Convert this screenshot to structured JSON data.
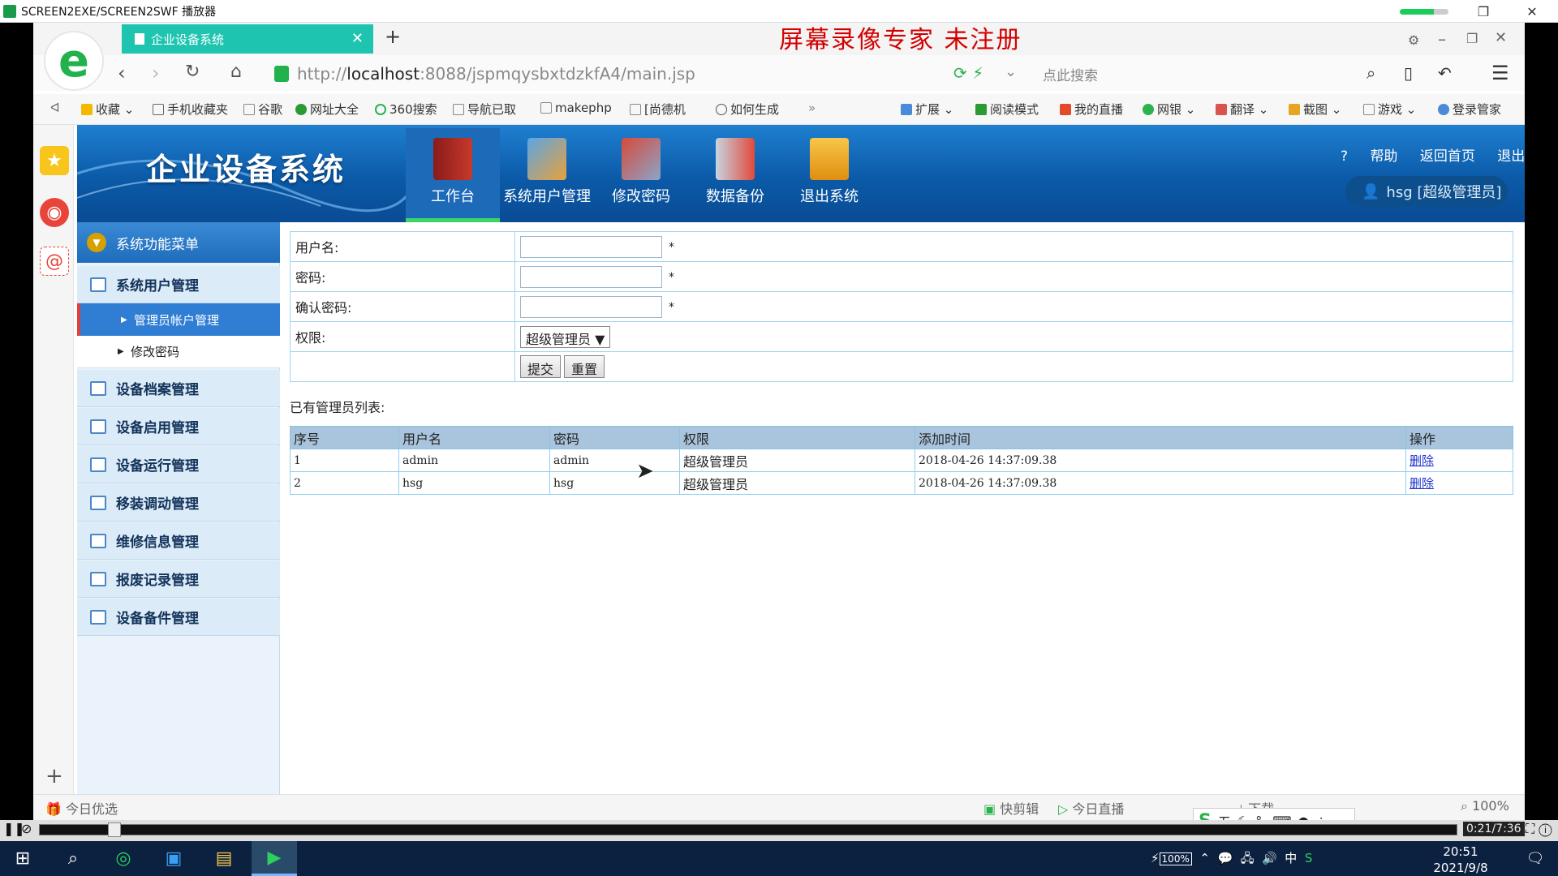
{
  "player": {
    "title": "SCREEN2EXE/SCREEN2SWF 播放器",
    "watermark": "屏幕录像专家  未注册",
    "time": "0:21/7:36"
  },
  "browser": {
    "tab_title": "企业设备系统",
    "url_prefix": "http://",
    "url_host": "localhost",
    "url_rest": ":8088/jspmqysbxtdzkfA4/main.jsp",
    "search_placeholder": "点此搜索",
    "bookmarks": [
      {
        "label": "收藏",
        "icon": "star-icon"
      },
      {
        "label": "手机收藏夹",
        "icon": "phone-icon"
      },
      {
        "label": "谷歌",
        "icon": "page-icon"
      },
      {
        "label": "网址大全",
        "icon": "globe-icon"
      },
      {
        "label": "360搜索",
        "icon": "search-icon"
      },
      {
        "label": "导航已取",
        "icon": "page-icon"
      },
      {
        "label": "makephp",
        "icon": "page-icon"
      },
      {
        "label": "[尚德机",
        "icon": "page-icon"
      },
      {
        "label": "如何生成",
        "icon": "search-icon"
      }
    ],
    "toolbar_right": [
      {
        "label": "扩展",
        "icon": "grid-icon"
      },
      {
        "label": "阅读模式",
        "icon": "book-icon"
      },
      {
        "label": "我的直播",
        "icon": "tv-icon"
      },
      {
        "label": "网银",
        "icon": "shield-icon"
      },
      {
        "label": "翻译",
        "icon": "translate-icon"
      },
      {
        "label": "截图",
        "icon": "scissors-icon"
      },
      {
        "label": "游戏",
        "icon": "game-icon"
      },
      {
        "label": "登录管家",
        "icon": "key-icon"
      }
    ],
    "status_left": "今日优选",
    "status_items": [
      "快剪辑",
      "今日直播",
      "下载"
    ],
    "zoom": "100%"
  },
  "site": {
    "title": "企业设备系统",
    "top_nav": [
      {
        "label": "工作台",
        "icon": "book-icon"
      },
      {
        "label": "系统用户管理",
        "icon": "ruler-icon"
      },
      {
        "label": "修改密码",
        "icon": "tools-icon"
      },
      {
        "label": "数据备份",
        "icon": "wrench-icon"
      },
      {
        "label": "退出系统",
        "icon": "download-folder-icon"
      }
    ],
    "links": {
      "help": "帮助",
      "home": "返回首页",
      "logout": "退出"
    },
    "user_badge": "hsg [超级管理员]"
  },
  "menu": {
    "header": "系统功能菜单",
    "group1": "系统用户管理",
    "sub_items": [
      "管理员帐户管理",
      "修改密码"
    ],
    "groups": [
      "设备档案管理",
      "设备启用管理",
      "设备运行管理",
      "移装调动管理",
      "维修信息管理",
      "报废记录管理",
      "设备备件管理"
    ]
  },
  "form": {
    "username_label": "用户名:",
    "password_label": "密码:",
    "confirm_label": "确认密码:",
    "role_label": "权限:",
    "required_mark": "*",
    "role_value": "超级管理员",
    "submit": "提交",
    "reset": "重置"
  },
  "list": {
    "title": "已有管理员列表:",
    "headers": [
      "序号",
      "用户名",
      "密码",
      "权限",
      "添加时间",
      "操作"
    ],
    "rows": [
      {
        "no": "1",
        "username": "admin",
        "password": "admin",
        "role": "超级管理员",
        "time": "2018-04-26 14:37:09.38",
        "action": "删除"
      },
      {
        "no": "2",
        "username": "hsg",
        "password": "hsg",
        "role": "超级管理员",
        "time": "2018-04-26 14:37:09.38",
        "action": "删除"
      }
    ]
  },
  "taskbar": {
    "time": "20:51",
    "date": "2021/9/8",
    "battery": "100%",
    "ime_lang": "中",
    "ime_mode": "五"
  }
}
